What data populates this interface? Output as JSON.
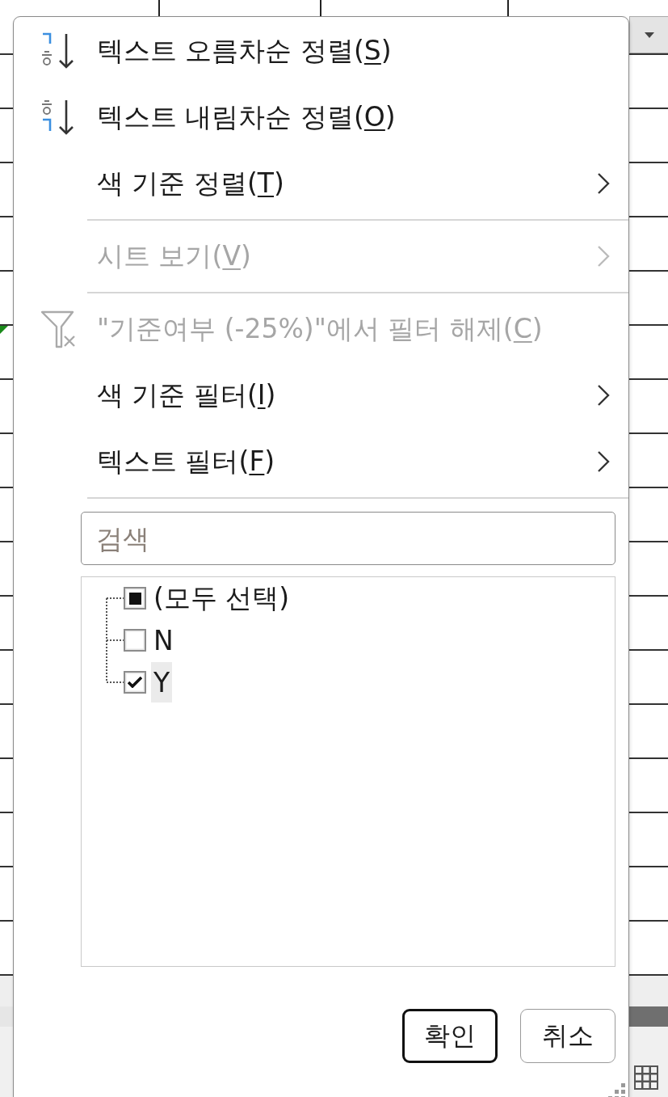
{
  "menu": {
    "items": [
      {
        "kind": "sort-asc",
        "label": [
          "텍스트 오름차순 정렬(",
          "S",
          ")"
        ],
        "disabled": false
      },
      {
        "kind": "sort-desc",
        "label": [
          "텍스트 내림차순 정렬(",
          "O",
          ")"
        ],
        "disabled": false
      },
      {
        "kind": "submenu",
        "label": [
          "색 기준 정렬(",
          "T",
          ")"
        ],
        "disabled": false
      },
      {
        "kind": "separator"
      },
      {
        "kind": "submenu",
        "label": [
          "시트 보기(",
          "V",
          ")"
        ],
        "disabled": true
      },
      {
        "kind": "separator"
      },
      {
        "kind": "clear-filter",
        "label": [
          "\"기준여부 (-25%)\"에서 필터 해제(",
          "C",
          ")"
        ],
        "disabled": true
      },
      {
        "kind": "submenu",
        "label": [
          "색 기준 필터(",
          "I",
          ")"
        ],
        "disabled": false
      },
      {
        "kind": "submenu",
        "label": [
          "텍스트 필터(",
          "F",
          ")"
        ],
        "disabled": false
      },
      {
        "kind": "separator"
      }
    ]
  },
  "search": {
    "placeholder": "검색"
  },
  "checklist": {
    "items": [
      {
        "label": "(모두 선택)",
        "checked": false,
        "indeterminate": true,
        "focused": false
      },
      {
        "label": "N",
        "checked": false,
        "indeterminate": false,
        "focused": false
      },
      {
        "label": "Y",
        "checked": true,
        "indeterminate": false,
        "focused": true
      }
    ]
  },
  "buttons": [
    {
      "label": "확인",
      "default": true
    },
    {
      "label": "취소",
      "default": false
    }
  ]
}
